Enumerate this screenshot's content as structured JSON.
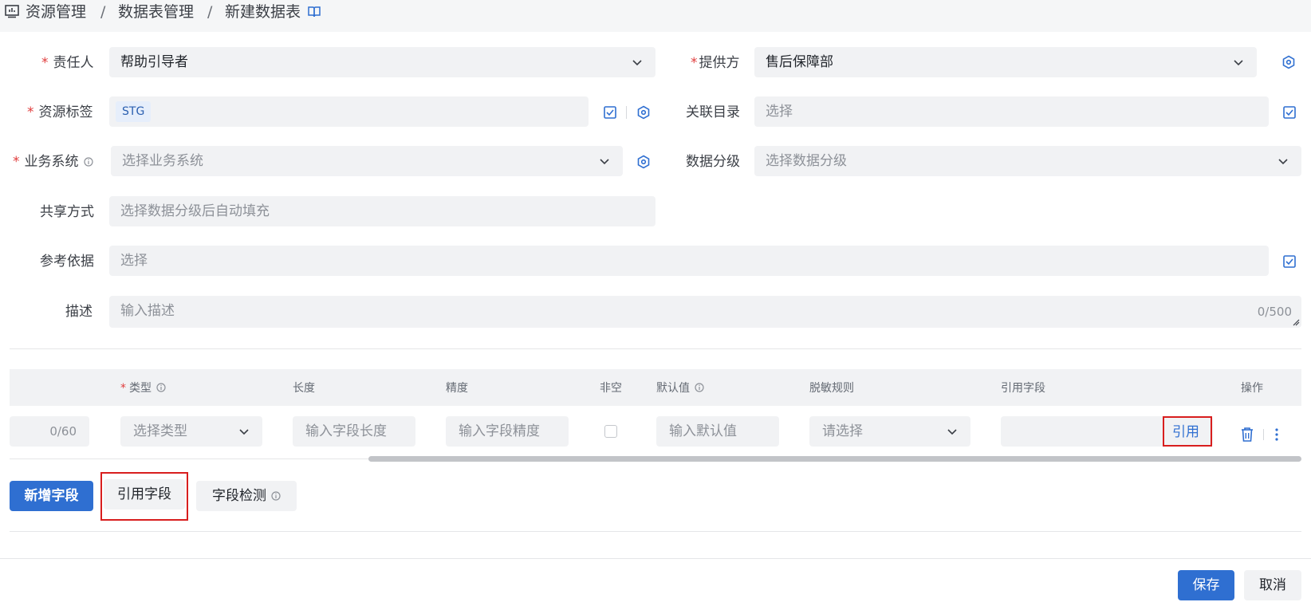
{
  "breadcrumb": {
    "items": [
      "资源管理",
      "数据表管理",
      "新建数据表"
    ],
    "separator": "/"
  },
  "form": {
    "owner": {
      "label": "责任人",
      "value": "帮助引导者"
    },
    "provider": {
      "label": "提供方",
      "value": "售后保障部"
    },
    "resource_tag": {
      "label": "资源标签",
      "tag": "STG"
    },
    "related_catalog": {
      "label": "关联目录",
      "placeholder": "选择"
    },
    "business_system": {
      "label": "业务系统",
      "placeholder": "选择业务系统"
    },
    "data_grade": {
      "label": "数据分级",
      "placeholder": "选择数据分级"
    },
    "share_mode": {
      "label": "共享方式",
      "placeholder": "选择数据分级后自动填充"
    },
    "reference_basis": {
      "label": "参考依据",
      "placeholder": "选择"
    },
    "description": {
      "label": "描述",
      "placeholder": "输入描述",
      "counter": "0/500"
    }
  },
  "table": {
    "headers": {
      "type": "类型",
      "length": "长度",
      "precision": "精度",
      "not_null": "非空",
      "default": "默认值",
      "mask_rule": "脱敏规则",
      "ref_field": "引用字段",
      "actions": "操作"
    },
    "row": {
      "name_counter": "0/60",
      "type_placeholder": "选择类型",
      "length_placeholder": "输入字段长度",
      "precision_placeholder": "输入字段精度",
      "default_placeholder": "输入默认值",
      "mask_placeholder": "请选择",
      "ref_button": "引用"
    }
  },
  "buttons": {
    "add_field": "新增字段",
    "ref_field": "引用字段",
    "field_check": "字段检测",
    "save": "保存",
    "cancel": "取消"
  },
  "colors": {
    "primary": "#2f6fd1",
    "required": "#e03c3c",
    "highlight": "#d81e1e",
    "input_bg": "#f1f2f4"
  }
}
